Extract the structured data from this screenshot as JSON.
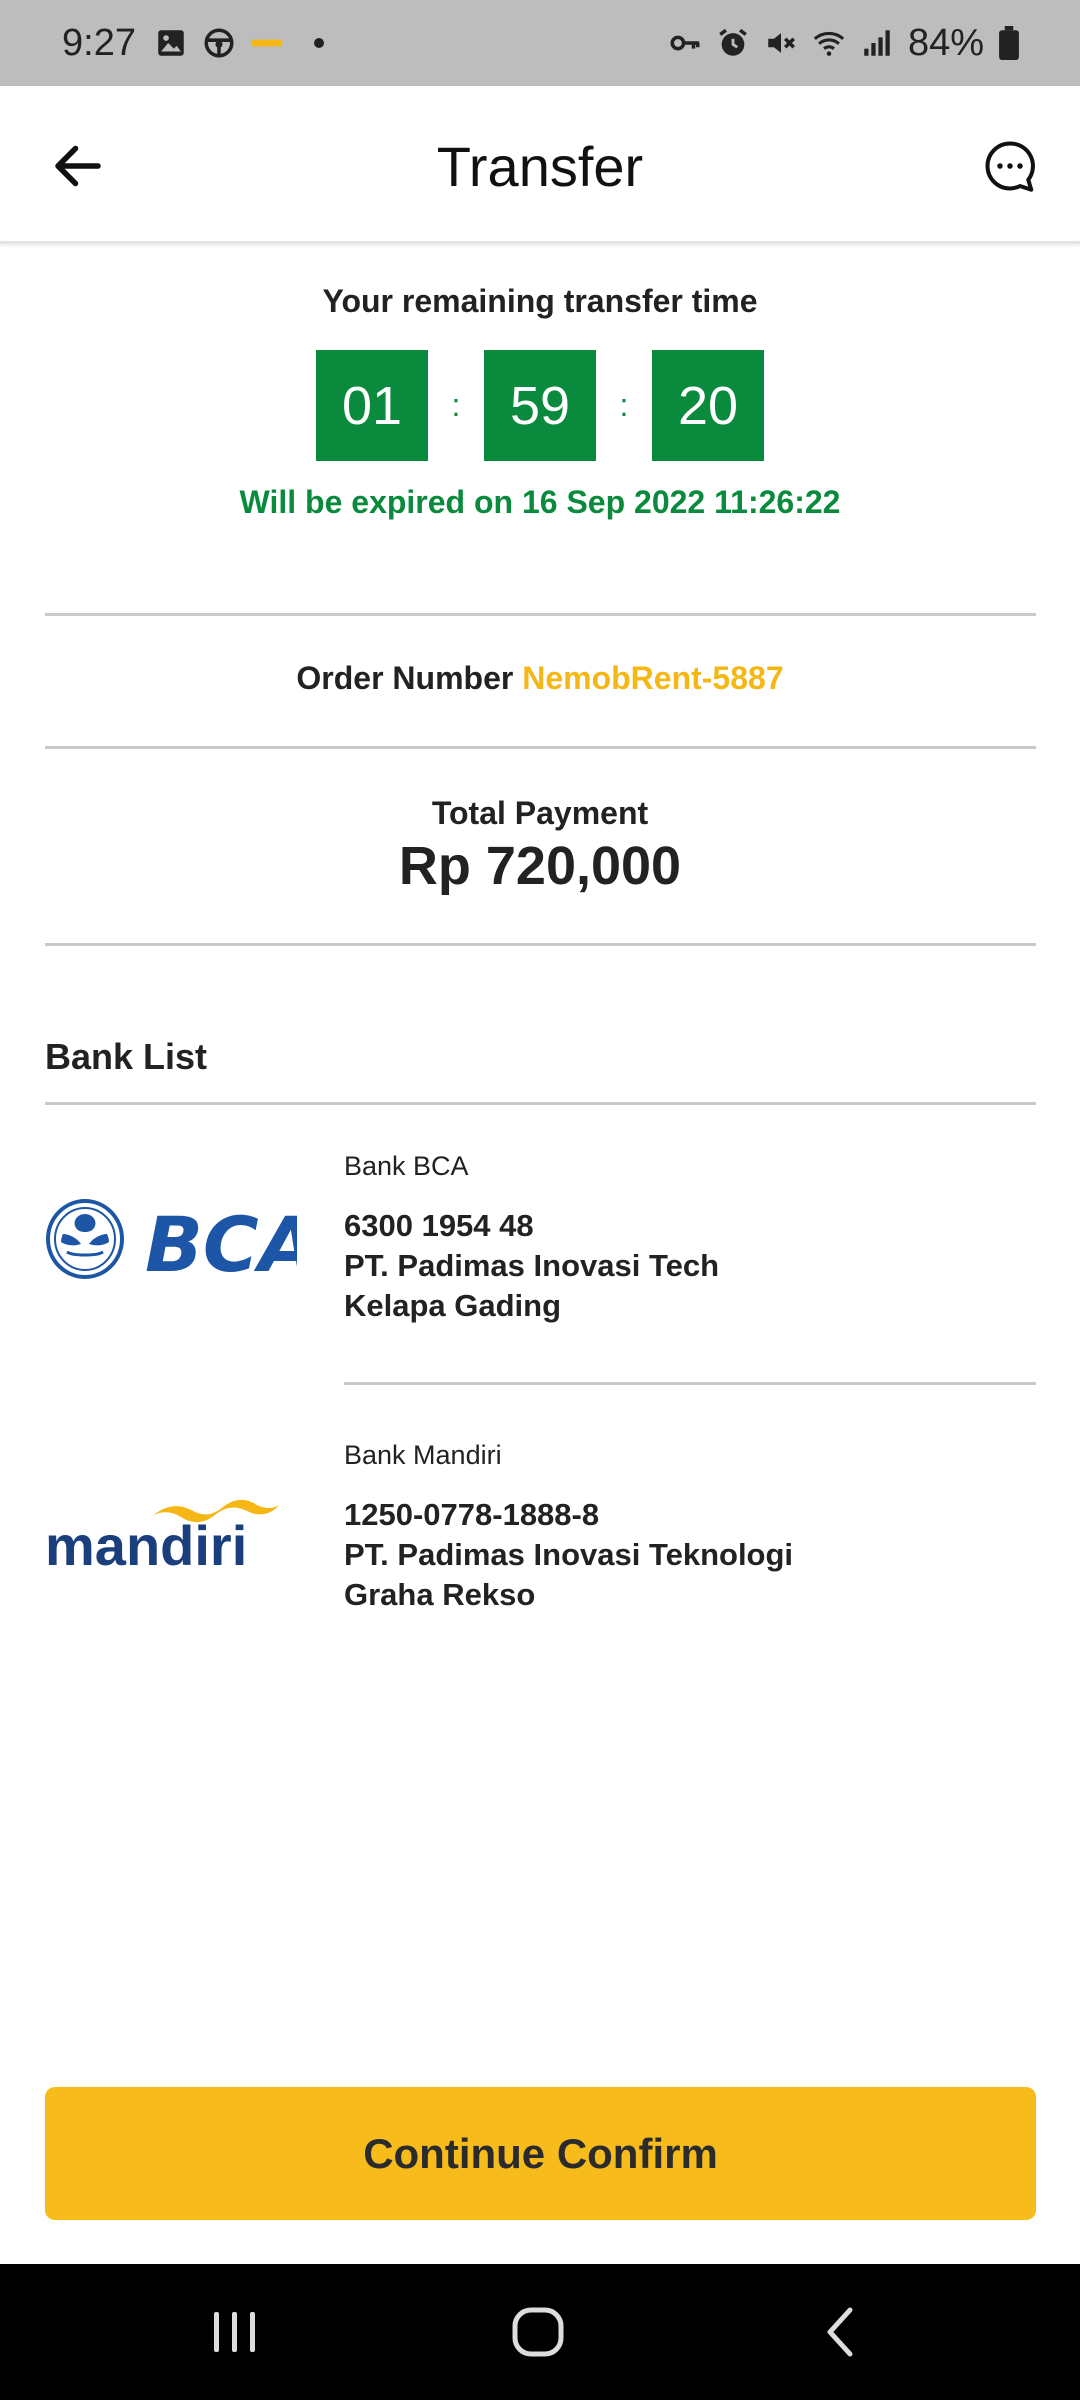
{
  "status_bar": {
    "time": "9:27",
    "battery": "84%",
    "left_icons": [
      "image-icon",
      "steering-wheel-icon",
      "app-icon",
      "dot-icon"
    ],
    "right_icons": [
      "key-icon",
      "alarm-icon",
      "mute-icon",
      "wifi-icon",
      "signal-icon",
      "battery-icon"
    ]
  },
  "app_bar": {
    "title": "Transfer",
    "back_icon": "arrow-left-icon",
    "chat_icon": "chat-bubble-icon"
  },
  "timer": {
    "label": "Your remaining transfer time",
    "hours": "01",
    "minutes": "59",
    "seconds": "20",
    "separator": ":",
    "expiry_text": "Will be expired on 16 Sep 2022 11:26:22"
  },
  "order": {
    "label": "Order Number",
    "number": "NemobRent-5887"
  },
  "payment": {
    "label": "Total Payment",
    "amount": "Rp 720,000"
  },
  "bank_list": {
    "title": "Bank List",
    "banks": [
      {
        "logo": "bca-logo",
        "name": "Bank BCA",
        "account_number": "6300 1954 48",
        "account_holder": "PT. Padimas Inovasi Tech",
        "branch": "Kelapa Gading"
      },
      {
        "logo": "mandiri-logo",
        "logo_text": "mandiri",
        "name": "Bank Mandiri",
        "account_number": "1250-0778-1888-8",
        "account_holder": "PT. Padimas Inovasi Teknologi",
        "branch": "Graha Rekso"
      }
    ]
  },
  "actions": {
    "confirm_label": "Continue Confirm"
  },
  "colors": {
    "timer_green": "#0a8a3d",
    "accent_yellow": "#f7bc1b",
    "order_yellow": "#f5b716"
  },
  "nav_bar": {
    "icons": [
      "recent-apps-icon",
      "home-icon",
      "back-icon"
    ]
  }
}
